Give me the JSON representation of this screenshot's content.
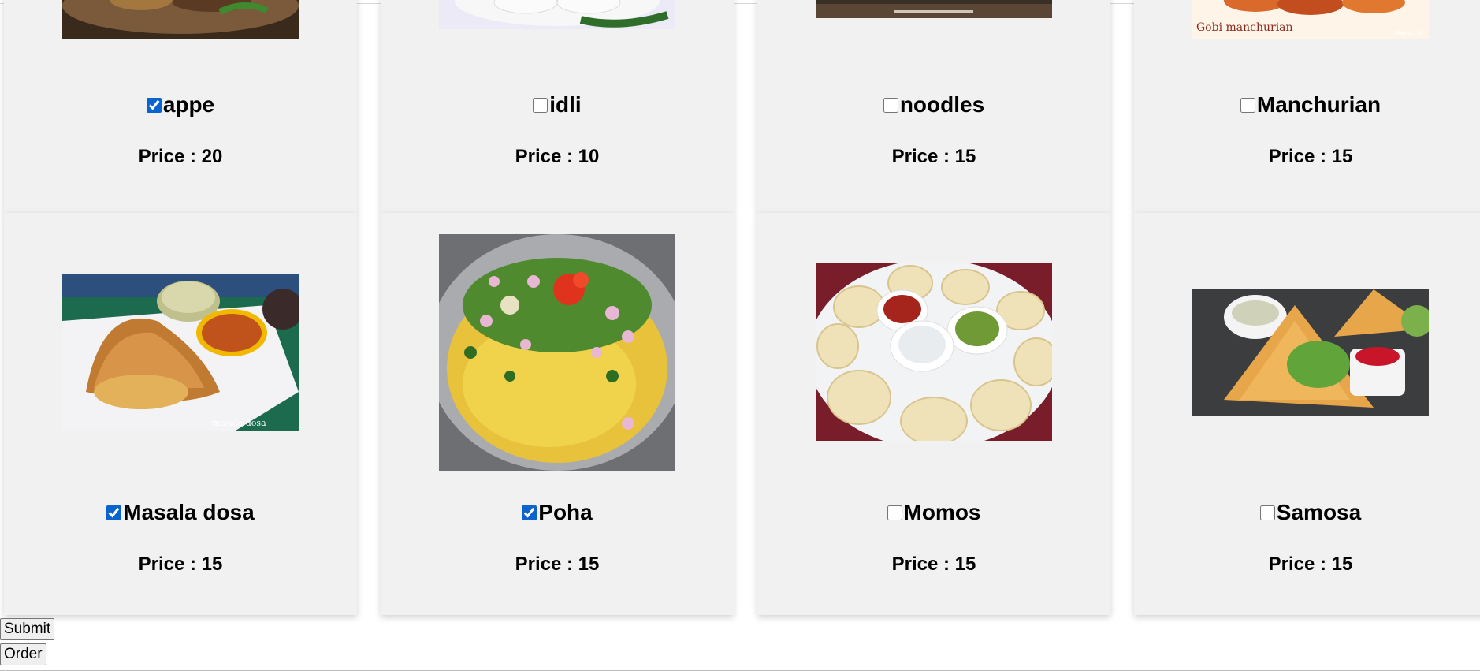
{
  "menu": {
    "row1": [
      {
        "name": "appe",
        "checked": true,
        "price_text": "Price : 20"
      },
      {
        "name": "idli",
        "checked": false,
        "price_text": "Price : 10"
      },
      {
        "name": "noodles",
        "checked": false,
        "price_text": "Price : 15"
      },
      {
        "name": "Manchurian",
        "checked": false,
        "price_text": "Price : 15",
        "image_caption": "Gobi manchurian",
        "image_watermark": "Swasthi"
      }
    ],
    "row2": [
      {
        "name": "Masala dosa",
        "checked": true,
        "price_text": "Price : 15",
        "image_caption": "masala dosa"
      },
      {
        "name": "Poha",
        "checked": true,
        "price_text": "Price : 15"
      },
      {
        "name": "Momos",
        "checked": false,
        "price_text": "Price : 15"
      },
      {
        "name": "Samosa",
        "checked": false,
        "price_text": "Price : 15"
      }
    ]
  },
  "actions": {
    "submit_label": "Submit",
    "order_label": "Order"
  },
  "colors": {
    "card_bg": "#f1f1f1",
    "checkbox_accent": "#0b63ce"
  }
}
